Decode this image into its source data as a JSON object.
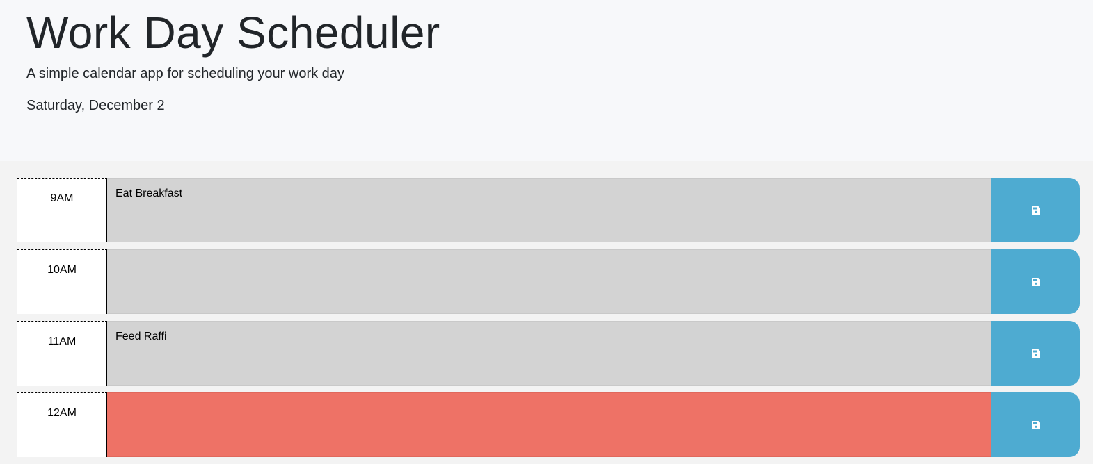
{
  "header": {
    "title": "Work Day Scheduler",
    "subtitle": "A simple calendar app for scheduling your work day",
    "current_day": "Saturday, December 2"
  },
  "colors": {
    "past": "#d3d3d3",
    "present": "#ee7266",
    "save_button": "#4eabd1"
  },
  "time_blocks": [
    {
      "hour": "9AM",
      "text": "Eat Breakfast",
      "status": "past",
      "save_icon": "floppy-disk-icon"
    },
    {
      "hour": "10AM",
      "text": "",
      "status": "past",
      "save_icon": "floppy-disk-icon"
    },
    {
      "hour": "11AM",
      "text": "Feed Raffi",
      "status": "past",
      "save_icon": "floppy-disk-icon"
    },
    {
      "hour": "12AM",
      "text": "",
      "status": "present",
      "save_icon": "floppy-disk-icon"
    }
  ]
}
